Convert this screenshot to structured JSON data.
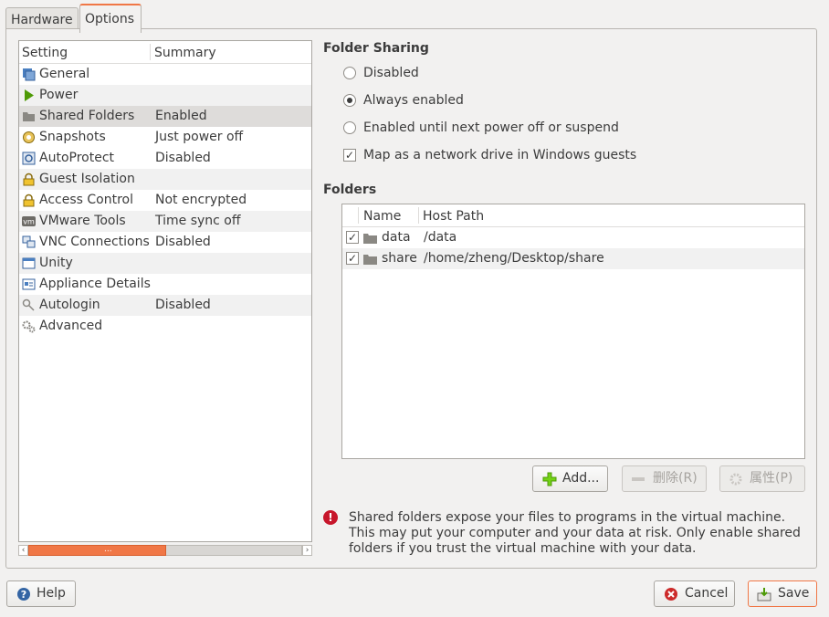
{
  "tabs": [
    {
      "label": "Hardware"
    },
    {
      "label": "Options"
    }
  ],
  "settings_list": {
    "col_setting": "Setting",
    "col_summary": "Summary",
    "rows": [
      {
        "name": "General",
        "summary": "",
        "icon": "general-icon"
      },
      {
        "name": "Power",
        "summary": "",
        "icon": "power-play-icon"
      },
      {
        "name": "Shared Folders",
        "summary": "Enabled",
        "icon": "folder-icon"
      },
      {
        "name": "Snapshots",
        "summary": "Just power off",
        "icon": "snapshot-icon"
      },
      {
        "name": "AutoProtect",
        "summary": "Disabled",
        "icon": "autoprotect-icon"
      },
      {
        "name": "Guest Isolation",
        "summary": "",
        "icon": "lock-icon"
      },
      {
        "name": "Access Control",
        "summary": "Not encrypted",
        "icon": "lock-icon"
      },
      {
        "name": "VMware Tools",
        "summary": "Time sync off",
        "icon": "vm-icon"
      },
      {
        "name": "VNC Connections",
        "summary": "Disabled",
        "icon": "vnc-icon"
      },
      {
        "name": "Unity",
        "summary": "",
        "icon": "unity-window-icon"
      },
      {
        "name": "Appliance Details",
        "summary": "",
        "icon": "appliance-icon"
      },
      {
        "name": "Autologin",
        "summary": "Disabled",
        "icon": "key-icon"
      },
      {
        "name": "Advanced",
        "summary": "",
        "icon": "gears-icon"
      }
    ],
    "scroll_grip": "..."
  },
  "folder_sharing": {
    "heading": "Folder Sharing",
    "options": [
      {
        "label": "Disabled",
        "selected": false
      },
      {
        "label": "Always enabled",
        "selected": true
      },
      {
        "label": "Enabled until next power off or suspend",
        "selected": false
      }
    ],
    "map_network_drive": {
      "label": "Map as a network drive in Windows guests",
      "checked": true,
      "mark": "✓"
    }
  },
  "folders": {
    "heading": "Folders",
    "col_name": "Name",
    "col_host_path": "Host Path",
    "rows": [
      {
        "name": "data",
        "path": "/data",
        "checked": true
      },
      {
        "name": "share",
        "path": "/home/zheng/Desktop/share",
        "checked": true
      }
    ]
  },
  "buttons": {
    "add": "Add...",
    "remove": "删除(R)",
    "properties": "属性(P)",
    "help": "Help",
    "cancel": "Cancel",
    "save": "Save"
  },
  "warning": {
    "mark": "!",
    "text": "Shared folders expose your files to programs in the virtual machine. This may put your computer and your data at risk. Only enable shared folders if you trust the virtual machine with your data."
  },
  "colors": {
    "accent": "#f07746",
    "warning": "#c7162b",
    "add_green": "#4e9a06",
    "cancel_red": "#cc2a2a"
  }
}
